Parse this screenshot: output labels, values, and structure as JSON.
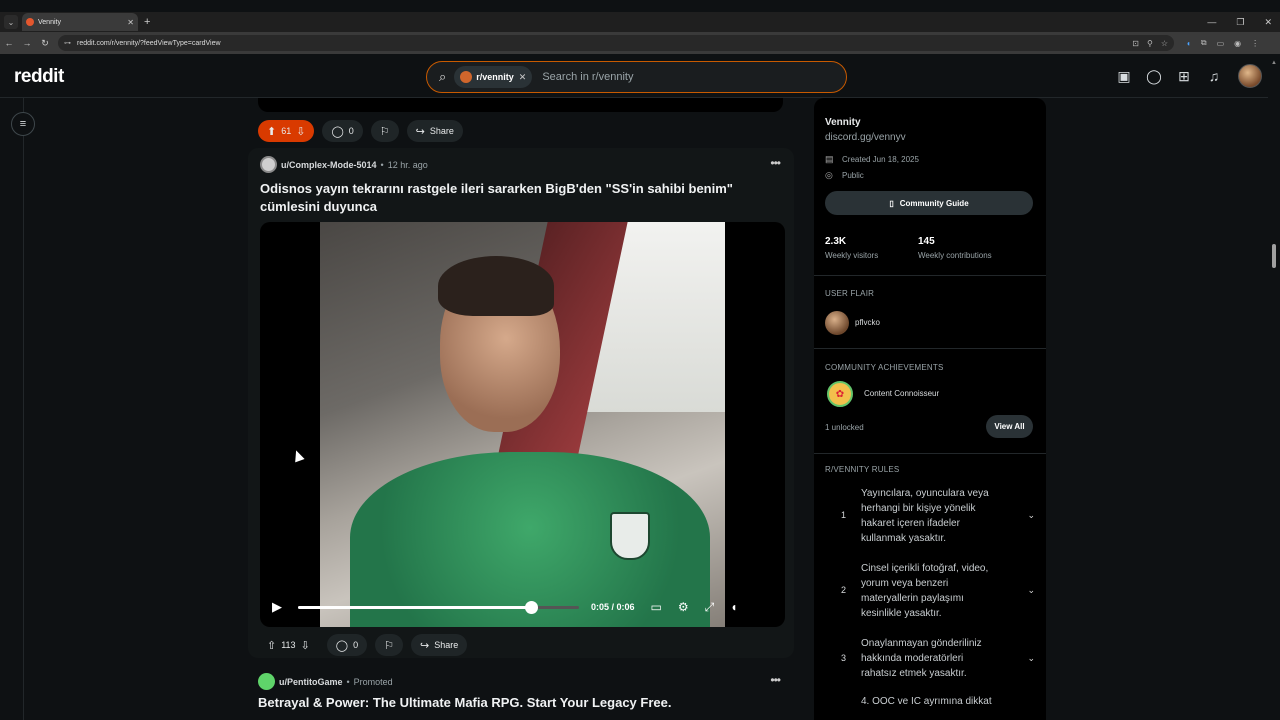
{
  "browser": {
    "tab_title": "Vennity",
    "url": "reddit.com/r/vennity/?feedViewType=cardView",
    "tab_close": "✕",
    "newtab": "+"
  },
  "header": {
    "logo": "reddit",
    "search_chip": "r/vennity",
    "search_placeholder": "Search in r/vennity"
  },
  "prev_post": {
    "votes": "61",
    "comments": "0",
    "share": "Share"
  },
  "post": {
    "username": "u/Complex-Mode-5014",
    "time": "12 hr. ago",
    "title": "Odisnos yayın tekrarını rastgele ileri sararken BigB'den \"SS'in sahibi benim\" cümlesini duyunca",
    "video_time": "0:05 / 0:06",
    "video_progress": 0.83,
    "votes": "113",
    "comments": "0",
    "share": "Share"
  },
  "promo": {
    "username": "u/PentitoGame",
    "label": "Promoted",
    "title": "Betrayal & Power: The Ultimate Mafia RPG. Start Your Legacy Free."
  },
  "sidebar": {
    "name": "Vennity",
    "link": "discord.gg/vennyv",
    "created": "Created Jun 18, 2025",
    "visibility": "Public",
    "guide_button": "Community Guide",
    "visitors_num": "2.3K",
    "visitors_label": "Weekly visitors",
    "contrib_num": "145",
    "contrib_label": "Weekly contributions",
    "user_flair_header": "USER FLAIR",
    "flair_name": "pflvcko",
    "achievements_header": "COMMUNITY ACHIEVEMENTS",
    "achievement_name": "Content Connoisseur",
    "unlocked": "1 unlocked",
    "view_all": "View All",
    "rules_header": "R/VENNITY RULES",
    "rules": [
      {
        "num": "1",
        "text": "Yayıncılara, oyunculara veya herhangi bir kişiye yönelik hakaret içeren ifadeler kullanmak yasaktır."
      },
      {
        "num": "2",
        "text": "Cinsel içerikli fotoğraf, video, yorum veya benzeri materyallerin paylaşımı kesinlikle yasaktır."
      },
      {
        "num": "3",
        "text": "Onaylanmayan gönderiliniz hakkında moderatörleri rahatsız etmek yasaktır."
      }
    ],
    "rule_partial": "4. OOC ve IC ayrımına dikkat"
  },
  "colors": {
    "accent": "#d93a00",
    "search_border": "#c85a00",
    "bg": "#0e1113"
  }
}
